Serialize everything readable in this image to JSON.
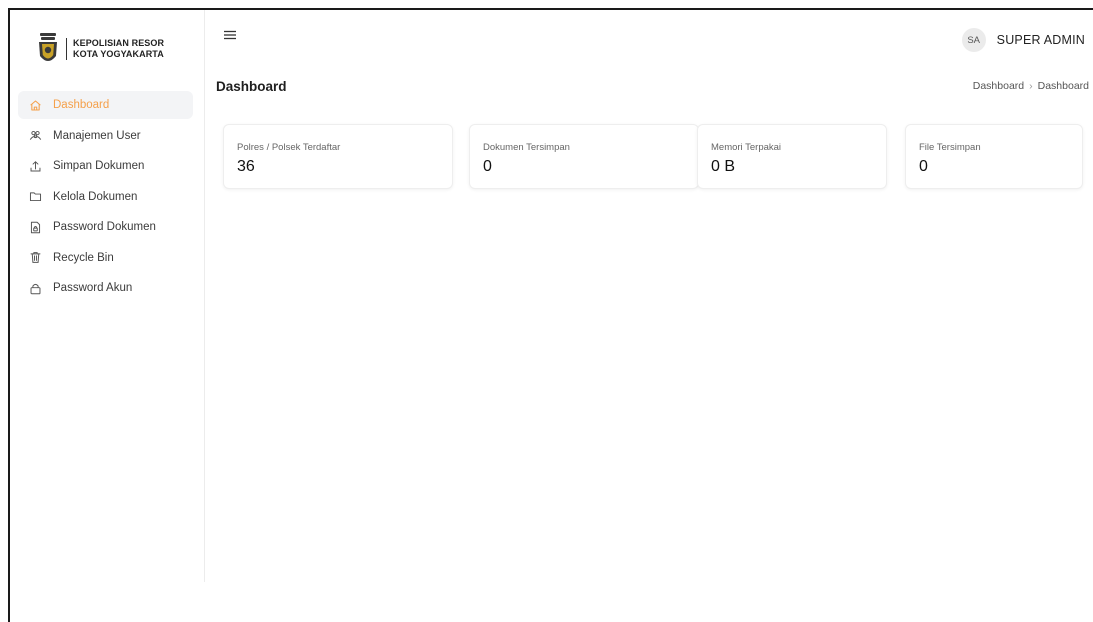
{
  "brand": {
    "line1": "KEPOLISIAN RESOR",
    "line2": "KOTA YOGYAKARTA"
  },
  "sidebar": {
    "items": [
      {
        "label": "Dashboard",
        "icon": "home-icon",
        "active": true
      },
      {
        "label": "Manajemen User",
        "icon": "users-icon"
      },
      {
        "label": "Simpan Dokumen",
        "icon": "upload-icon"
      },
      {
        "label": "Kelola Dokumen",
        "icon": "folder-icon"
      },
      {
        "label": "Password Dokumen",
        "icon": "file-lock-icon"
      },
      {
        "label": "Recycle Bin",
        "icon": "trash-icon"
      },
      {
        "label": "Password Akun",
        "icon": "lock-icon"
      }
    ]
  },
  "header": {
    "avatar_initials": "SA",
    "user_name": "SUPER ADMIN",
    "page_title": "Dashboard",
    "breadcrumb": [
      "Dashboard",
      "Dashboard"
    ],
    "breadcrumb_separator": "›"
  },
  "stats": [
    {
      "label": "Polres / Polsek Terdaftar",
      "value": "36"
    },
    {
      "label": "Dokumen Tersimpan",
      "value": "0"
    },
    {
      "label": "Memori Terpakai",
      "value": "0 B"
    },
    {
      "label": "File Tersimpan",
      "value": "0"
    }
  ],
  "colors": {
    "accent": "#f5a04a",
    "active_bg": "#f3f4f6",
    "border": "#eeeeee",
    "logo_dark": "#3a3a3a",
    "logo_gold": "#c9a227"
  }
}
